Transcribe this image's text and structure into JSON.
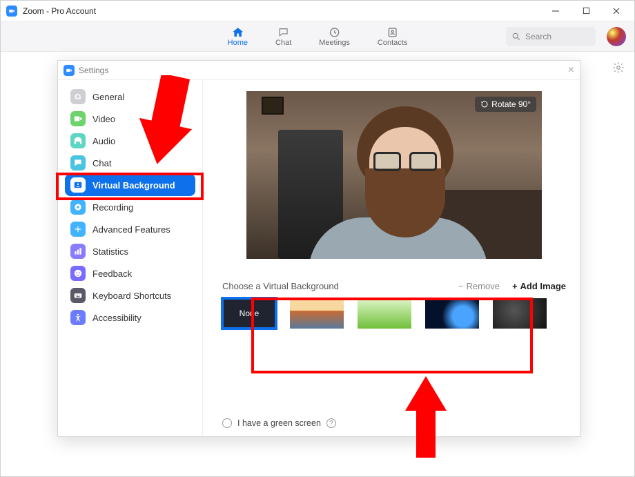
{
  "window": {
    "title": "Zoom - Pro Account"
  },
  "nav": {
    "tabs": [
      {
        "label": "Home",
        "active": true
      },
      {
        "label": "Chat",
        "active": false
      },
      {
        "label": "Meetings",
        "active": false
      },
      {
        "label": "Contacts",
        "active": false
      }
    ],
    "search_placeholder": "Search"
  },
  "settings": {
    "title": "Settings",
    "sidebar": [
      {
        "label": "General"
      },
      {
        "label": "Video"
      },
      {
        "label": "Audio"
      },
      {
        "label": "Chat"
      },
      {
        "label": "Virtual Background",
        "selected": true
      },
      {
        "label": "Recording"
      },
      {
        "label": "Advanced Features"
      },
      {
        "label": "Statistics"
      },
      {
        "label": "Feedback"
      },
      {
        "label": "Keyboard Shortcuts"
      },
      {
        "label": "Accessibility"
      }
    ],
    "preview": {
      "rotate_label": "Rotate 90°"
    },
    "choose_label": "Choose a Virtual Background",
    "remove_label": "Remove",
    "add_label": "Add Image",
    "thumbs": {
      "none_label": "None",
      "items": [
        "none",
        "bridge",
        "grass",
        "earth",
        "blur"
      ]
    },
    "green_screen_label": "I have a green screen"
  }
}
